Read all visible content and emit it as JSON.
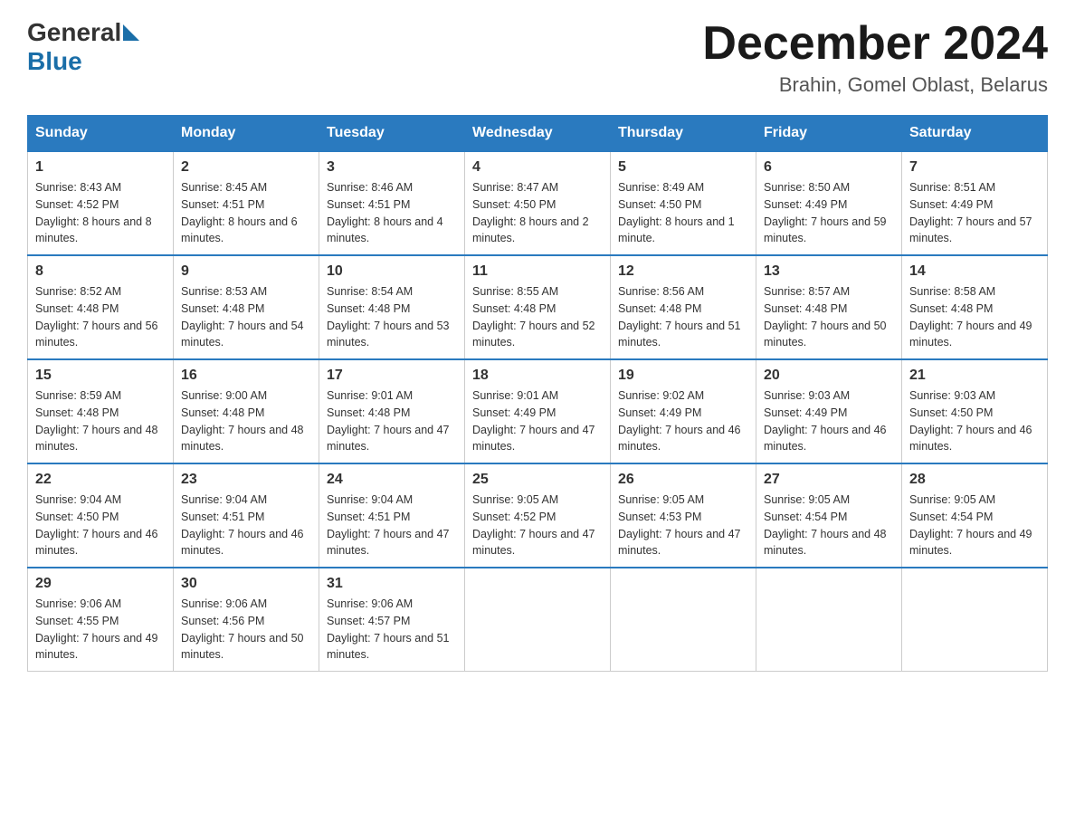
{
  "logo": {
    "general": "General",
    "blue": "Blue"
  },
  "title": {
    "month": "December 2024",
    "location": "Brahin, Gomel Oblast, Belarus"
  },
  "days_of_week": [
    "Sunday",
    "Monday",
    "Tuesday",
    "Wednesday",
    "Thursday",
    "Friday",
    "Saturday"
  ],
  "weeks": [
    [
      {
        "day": "1",
        "sunrise": "8:43 AM",
        "sunset": "4:52 PM",
        "daylight": "8 hours and 8 minutes."
      },
      {
        "day": "2",
        "sunrise": "8:45 AM",
        "sunset": "4:51 PM",
        "daylight": "8 hours and 6 minutes."
      },
      {
        "day": "3",
        "sunrise": "8:46 AM",
        "sunset": "4:51 PM",
        "daylight": "8 hours and 4 minutes."
      },
      {
        "day": "4",
        "sunrise": "8:47 AM",
        "sunset": "4:50 PM",
        "daylight": "8 hours and 2 minutes."
      },
      {
        "day": "5",
        "sunrise": "8:49 AM",
        "sunset": "4:50 PM",
        "daylight": "8 hours and 1 minute."
      },
      {
        "day": "6",
        "sunrise": "8:50 AM",
        "sunset": "4:49 PM",
        "daylight": "7 hours and 59 minutes."
      },
      {
        "day": "7",
        "sunrise": "8:51 AM",
        "sunset": "4:49 PM",
        "daylight": "7 hours and 57 minutes."
      }
    ],
    [
      {
        "day": "8",
        "sunrise": "8:52 AM",
        "sunset": "4:48 PM",
        "daylight": "7 hours and 56 minutes."
      },
      {
        "day": "9",
        "sunrise": "8:53 AM",
        "sunset": "4:48 PM",
        "daylight": "7 hours and 54 minutes."
      },
      {
        "day": "10",
        "sunrise": "8:54 AM",
        "sunset": "4:48 PM",
        "daylight": "7 hours and 53 minutes."
      },
      {
        "day": "11",
        "sunrise": "8:55 AM",
        "sunset": "4:48 PM",
        "daylight": "7 hours and 52 minutes."
      },
      {
        "day": "12",
        "sunrise": "8:56 AM",
        "sunset": "4:48 PM",
        "daylight": "7 hours and 51 minutes."
      },
      {
        "day": "13",
        "sunrise": "8:57 AM",
        "sunset": "4:48 PM",
        "daylight": "7 hours and 50 minutes."
      },
      {
        "day": "14",
        "sunrise": "8:58 AM",
        "sunset": "4:48 PM",
        "daylight": "7 hours and 49 minutes."
      }
    ],
    [
      {
        "day": "15",
        "sunrise": "8:59 AM",
        "sunset": "4:48 PM",
        "daylight": "7 hours and 48 minutes."
      },
      {
        "day": "16",
        "sunrise": "9:00 AM",
        "sunset": "4:48 PM",
        "daylight": "7 hours and 48 minutes."
      },
      {
        "day": "17",
        "sunrise": "9:01 AM",
        "sunset": "4:48 PM",
        "daylight": "7 hours and 47 minutes."
      },
      {
        "day": "18",
        "sunrise": "9:01 AM",
        "sunset": "4:49 PM",
        "daylight": "7 hours and 47 minutes."
      },
      {
        "day": "19",
        "sunrise": "9:02 AM",
        "sunset": "4:49 PM",
        "daylight": "7 hours and 46 minutes."
      },
      {
        "day": "20",
        "sunrise": "9:03 AM",
        "sunset": "4:49 PM",
        "daylight": "7 hours and 46 minutes."
      },
      {
        "day": "21",
        "sunrise": "9:03 AM",
        "sunset": "4:50 PM",
        "daylight": "7 hours and 46 minutes."
      }
    ],
    [
      {
        "day": "22",
        "sunrise": "9:04 AM",
        "sunset": "4:50 PM",
        "daylight": "7 hours and 46 minutes."
      },
      {
        "day": "23",
        "sunrise": "9:04 AM",
        "sunset": "4:51 PM",
        "daylight": "7 hours and 46 minutes."
      },
      {
        "day": "24",
        "sunrise": "9:04 AM",
        "sunset": "4:51 PM",
        "daylight": "7 hours and 47 minutes."
      },
      {
        "day": "25",
        "sunrise": "9:05 AM",
        "sunset": "4:52 PM",
        "daylight": "7 hours and 47 minutes."
      },
      {
        "day": "26",
        "sunrise": "9:05 AM",
        "sunset": "4:53 PM",
        "daylight": "7 hours and 47 minutes."
      },
      {
        "day": "27",
        "sunrise": "9:05 AM",
        "sunset": "4:54 PM",
        "daylight": "7 hours and 48 minutes."
      },
      {
        "day": "28",
        "sunrise": "9:05 AM",
        "sunset": "4:54 PM",
        "daylight": "7 hours and 49 minutes."
      }
    ],
    [
      {
        "day": "29",
        "sunrise": "9:06 AM",
        "sunset": "4:55 PM",
        "daylight": "7 hours and 49 minutes."
      },
      {
        "day": "30",
        "sunrise": "9:06 AM",
        "sunset": "4:56 PM",
        "daylight": "7 hours and 50 minutes."
      },
      {
        "day": "31",
        "sunrise": "9:06 AM",
        "sunset": "4:57 PM",
        "daylight": "7 hours and 51 minutes."
      },
      null,
      null,
      null,
      null
    ]
  ]
}
